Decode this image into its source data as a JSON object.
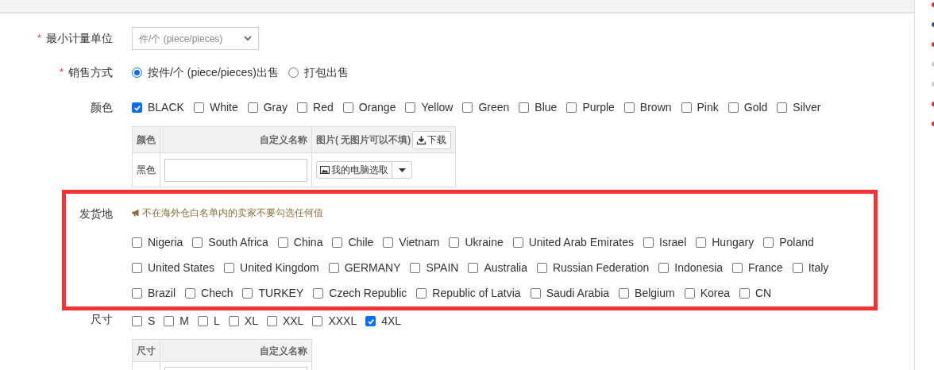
{
  "min_unit": {
    "label": "最小计量单位",
    "required_mark": "*",
    "value": "件/个 (piece/pieces)"
  },
  "sale_mode": {
    "label": "销售方式",
    "required_mark": "*",
    "options": [
      {
        "label": "按件/个 (piece/pieces)出售",
        "selected": true
      },
      {
        "label": "打包出售",
        "selected": false
      }
    ]
  },
  "color": {
    "label": "颜色",
    "options": [
      {
        "label": "BLACK",
        "checked": true
      },
      {
        "label": "White",
        "checked": false
      },
      {
        "label": "Gray",
        "checked": false
      },
      {
        "label": "Red",
        "checked": false
      },
      {
        "label": "Orange",
        "checked": false
      },
      {
        "label": "Yellow",
        "checked": false
      },
      {
        "label": "Green",
        "checked": false
      },
      {
        "label": "Blue",
        "checked": false
      },
      {
        "label": "Purple",
        "checked": false
      },
      {
        "label": "Brown",
        "checked": false
      },
      {
        "label": "Pink",
        "checked": false
      },
      {
        "label": "Gold",
        "checked": false
      },
      {
        "label": "Silver",
        "checked": false
      }
    ],
    "table": {
      "columns": [
        "颜色",
        "自定义名称",
        "图片( 无图片可以不填)"
      ],
      "download_button": "下载",
      "rows": [
        {
          "name": "黑色",
          "upload_button": "我的电脑选取"
        }
      ]
    }
  },
  "ship_from": {
    "label": "发货地",
    "note": "不在海外仓白名单内的卖家不要勾选任何值",
    "options": [
      {
        "label": "Nigeria",
        "checked": false
      },
      {
        "label": "South Africa",
        "checked": false
      },
      {
        "label": "China",
        "checked": false
      },
      {
        "label": "Chile",
        "checked": false
      },
      {
        "label": "Vietnam",
        "checked": false
      },
      {
        "label": "Ukraine",
        "checked": false
      },
      {
        "label": "United Arab Emirates",
        "checked": false
      },
      {
        "label": "Israel",
        "checked": false
      },
      {
        "label": "Hungary",
        "checked": false
      },
      {
        "label": "Poland",
        "checked": false
      },
      {
        "label": "United States",
        "checked": false
      },
      {
        "label": "United Kingdom",
        "checked": false
      },
      {
        "label": "GERMANY",
        "checked": false
      },
      {
        "label": "SPAIN",
        "checked": false
      },
      {
        "label": "Australia",
        "checked": false
      },
      {
        "label": "Russian Federation",
        "checked": false
      },
      {
        "label": "Indonesia",
        "checked": false
      },
      {
        "label": "France",
        "checked": false
      },
      {
        "label": "Italy",
        "checked": false
      },
      {
        "label": "Brazil",
        "checked": false
      },
      {
        "label": "Chech",
        "checked": false
      },
      {
        "label": "TURKEY",
        "checked": false
      },
      {
        "label": "Czech Republic",
        "checked": false
      },
      {
        "label": "Republic of Latvia",
        "checked": false
      },
      {
        "label": "Saudi Arabia",
        "checked": false
      },
      {
        "label": "Belgium",
        "checked": false
      },
      {
        "label": "Korea",
        "checked": false
      },
      {
        "label": "CN",
        "checked": false
      }
    ]
  },
  "size": {
    "label": "尺寸",
    "options": [
      {
        "label": "S",
        "checked": false
      },
      {
        "label": "M",
        "checked": false
      },
      {
        "label": "L",
        "checked": false
      },
      {
        "label": "XL",
        "checked": false
      },
      {
        "label": "XXL",
        "checked": false
      },
      {
        "label": "XXXL",
        "checked": false
      },
      {
        "label": "4XL",
        "checked": true
      }
    ],
    "table": {
      "columns": [
        "尺寸",
        "自定义名称"
      ]
    }
  },
  "side_marks": [
    {
      "color": "#e03030"
    },
    {
      "color": "#2a5a9a"
    },
    {
      "color": "#e03030"
    },
    {
      "color": "#c8c8c8"
    },
    {
      "color": "#c8c8c8"
    },
    {
      "color": "#e03030"
    },
    {
      "color": "#e03030"
    }
  ]
}
